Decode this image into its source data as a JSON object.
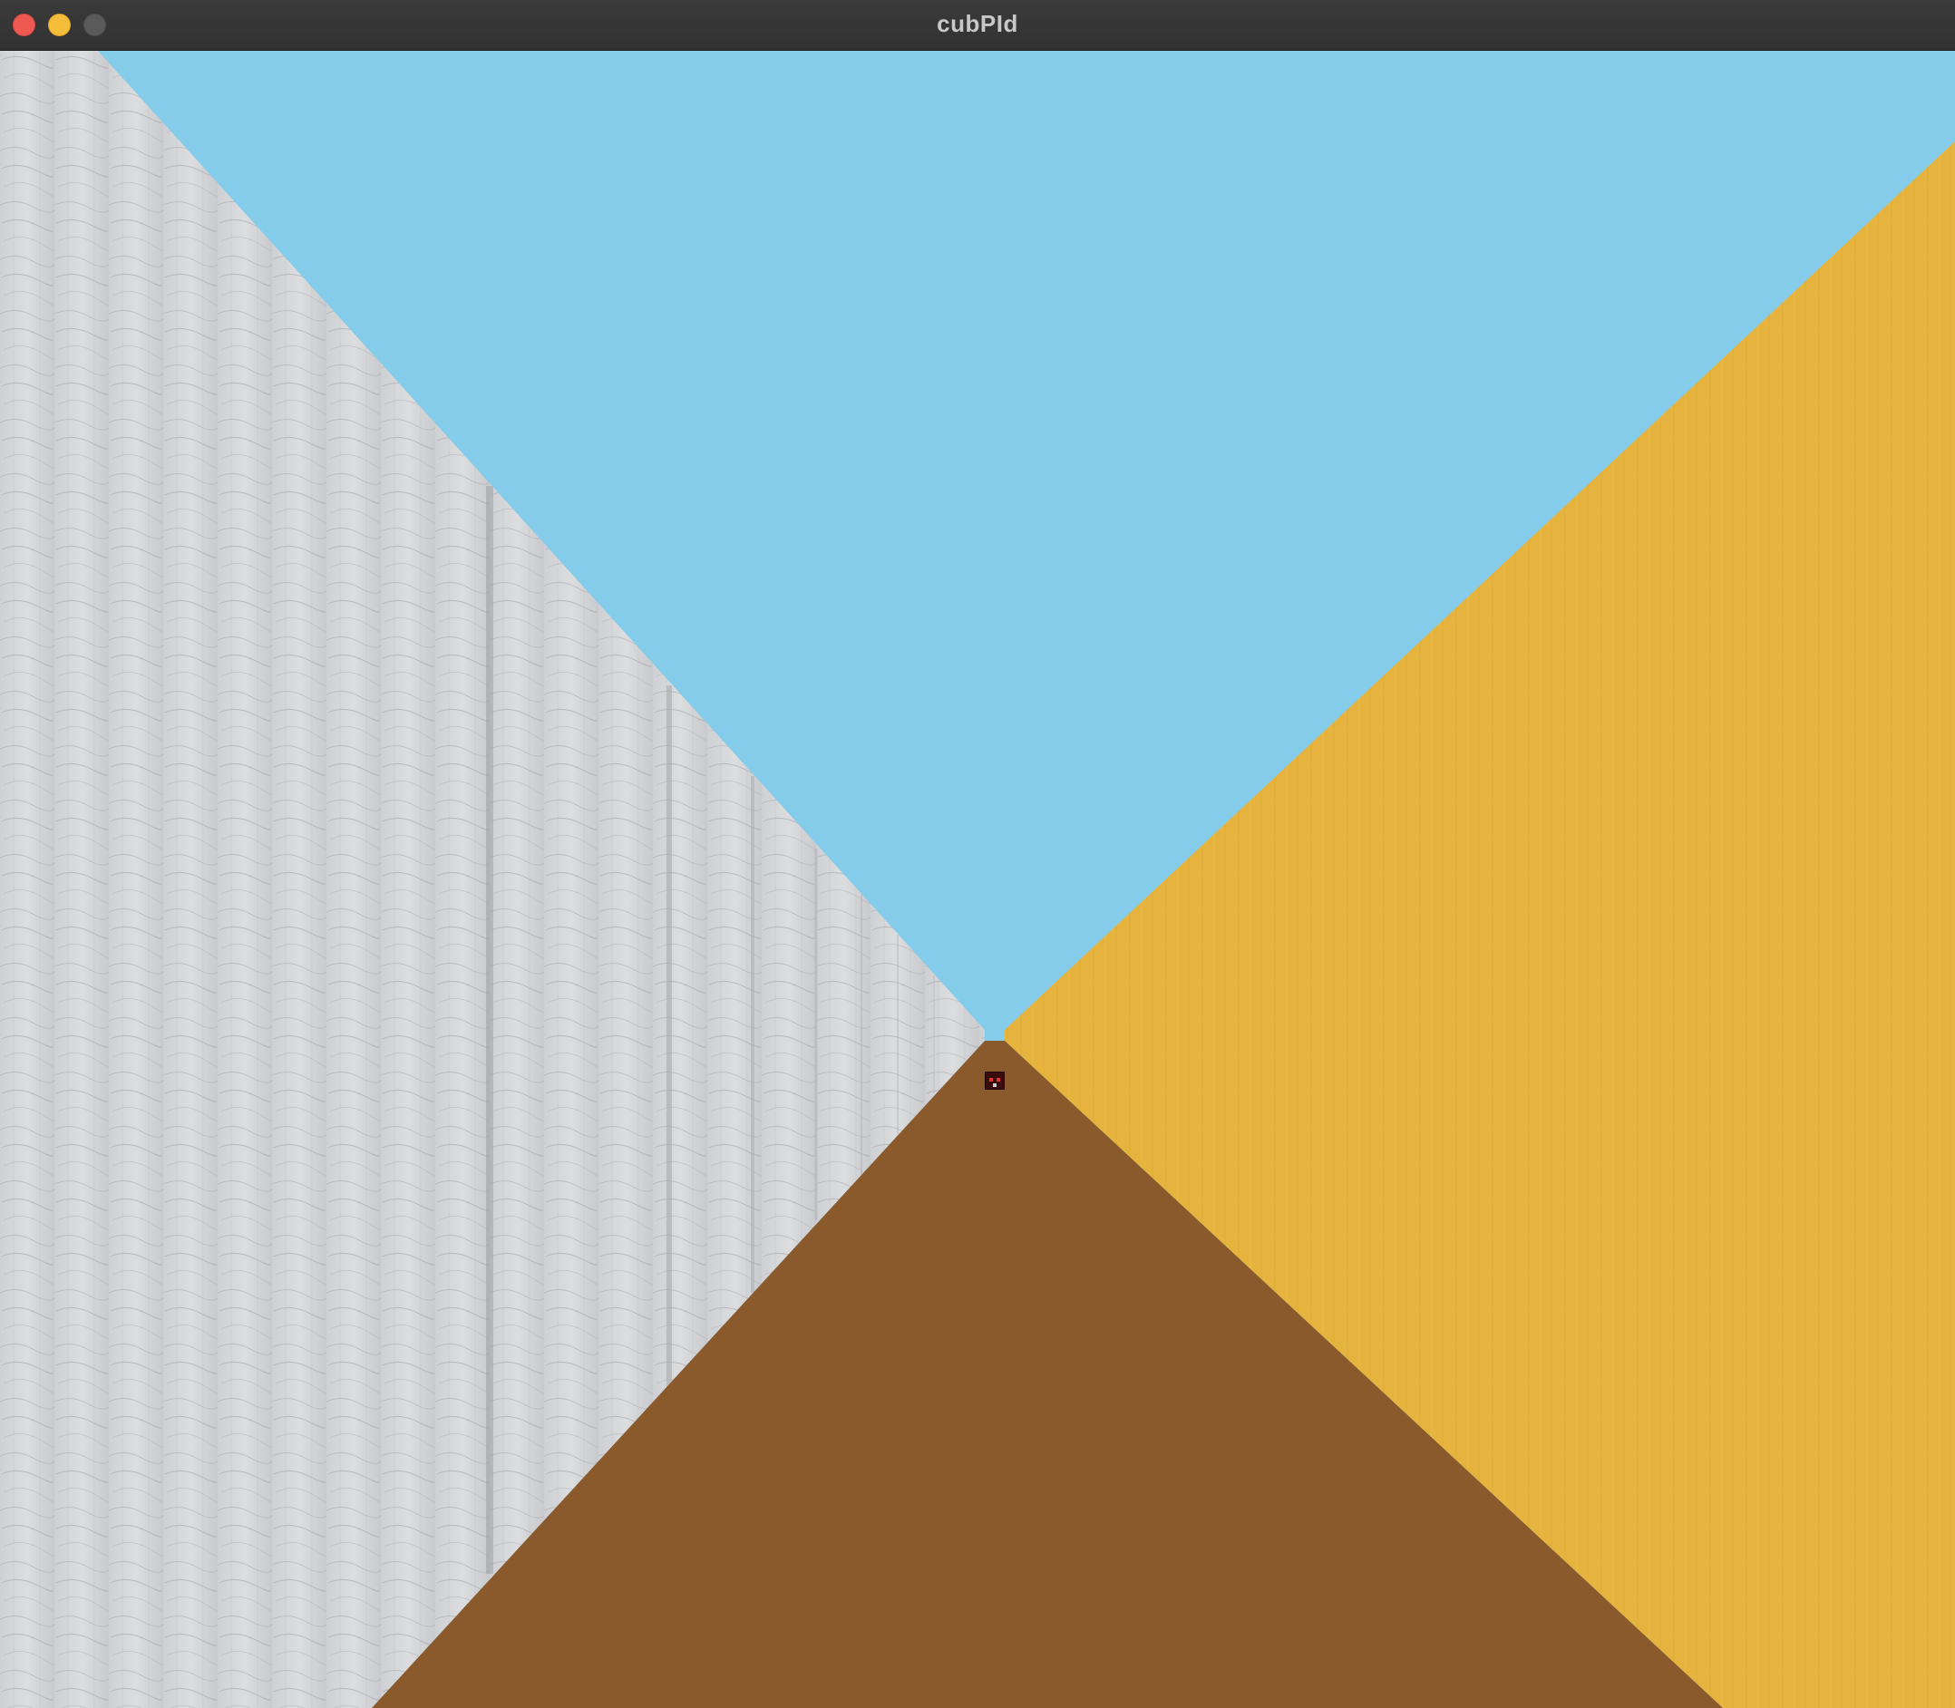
{
  "window": {
    "title": "cubPId",
    "controls": {
      "close_color": "#ee5a52",
      "minimize_color": "#f5be3a",
      "zoom_color": "#5a5a5a"
    }
  },
  "scene": {
    "sky_color": "#84cce9",
    "floor_color": "#8a5a2c",
    "left_wall_color": "#d9dadc",
    "right_wall_color": "#e6b43e",
    "sprite_icon": "enemy-sprite-icon"
  }
}
